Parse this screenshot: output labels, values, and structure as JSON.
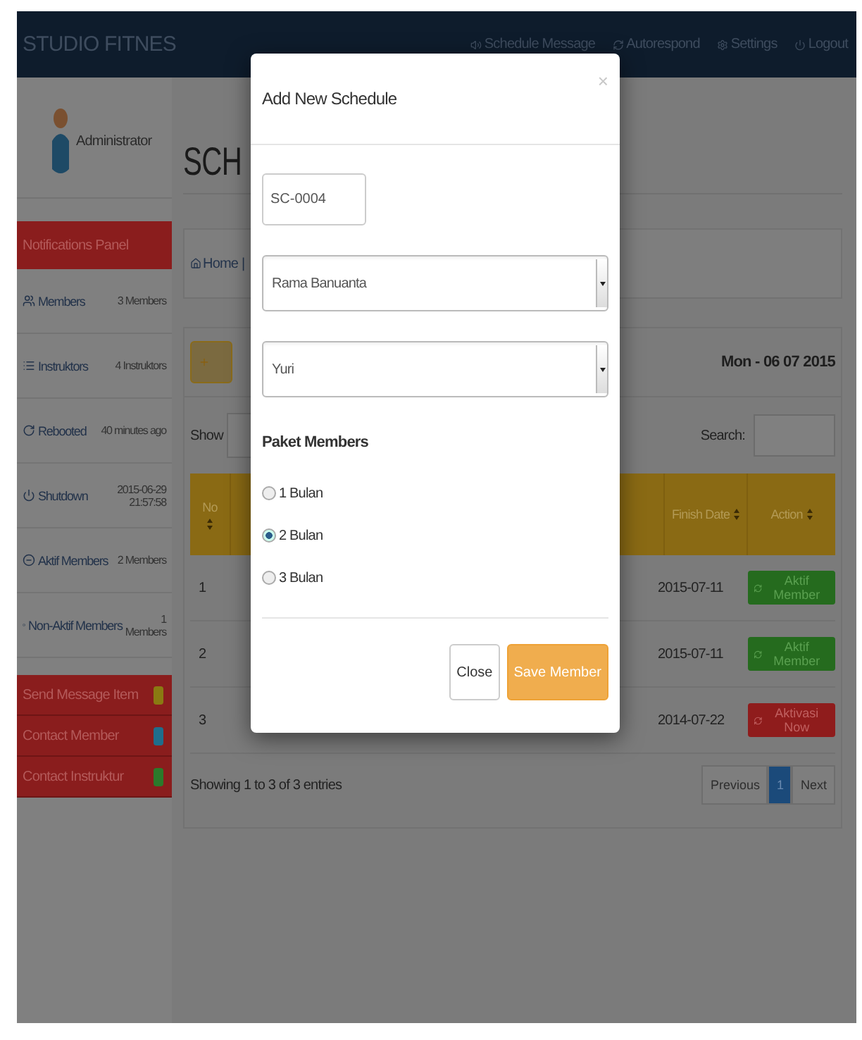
{
  "navbar": {
    "brand": "STUDIO FITNES",
    "links": [
      {
        "label": "Schedule Message"
      },
      {
        "label": "Autorespond"
      },
      {
        "label": "Settings"
      },
      {
        "label": "Logout"
      }
    ]
  },
  "sidebar": {
    "user": "Administrator",
    "panel_title": "Notifications Panel",
    "items": [
      {
        "label": "Members",
        "value": "3 Members"
      },
      {
        "label": "Instruktors",
        "value": "4 Instruktors"
      },
      {
        "label": "Rebooted",
        "value": "40 minutes ago"
      },
      {
        "label": "Shutdown",
        "value": "2015-06-29 21:57:58"
      },
      {
        "label": "Aktif Members",
        "value": "2 Members"
      },
      {
        "label": "Non-Aktif Members",
        "value": "1 Members"
      }
    ],
    "actions": [
      {
        "label": "Send Message Item",
        "color": "#8a7a12"
      },
      {
        "label": "Contact Member",
        "color": "#1f6e8c"
      },
      {
        "label": "Contact Instruktur",
        "color": "#2b7a2b"
      }
    ]
  },
  "main": {
    "title": "SCH",
    "breadcrumb": "Home |",
    "date": "Mon - 06 07 2015",
    "show_label": "Show",
    "search_label": "Search:",
    "columns": [
      {
        "label": "No"
      },
      {
        "label": "Finish Date"
      },
      {
        "label": "Action"
      }
    ],
    "rows": [
      {
        "no": "1",
        "finish": "2015-07-11",
        "action": {
          "label": "Aktif Member",
          "kind": "active"
        }
      },
      {
        "no": "2",
        "finish": "2015-07-11",
        "action": {
          "label": "Aktif Member",
          "kind": "active"
        }
      },
      {
        "no": "3",
        "finish": "2014-07-22",
        "action": {
          "label": "Aktivasi Now",
          "kind": "inactive"
        }
      }
    ],
    "info": "Showing 1 to 3 of 3 entries",
    "pagination": [
      {
        "label": "Previous",
        "selected": false
      },
      {
        "label": "1",
        "selected": true
      },
      {
        "label": "Next",
        "selected": false
      }
    ]
  },
  "modal": {
    "title": "Add New Schedule",
    "close": "×",
    "id_value": "SC-0004",
    "member_select": "Rama Banuanta",
    "instructor_select": "Yuri",
    "group_label": "Paket Members",
    "options": [
      {
        "label": "1 Bulan",
        "selected": false
      },
      {
        "label": "2 Bulan",
        "selected": true
      },
      {
        "label": "3 Bulan",
        "selected": false
      }
    ],
    "buttons": [
      {
        "label": "Close",
        "kind": "default"
      },
      {
        "label": "Save Member",
        "kind": "primary"
      }
    ]
  }
}
